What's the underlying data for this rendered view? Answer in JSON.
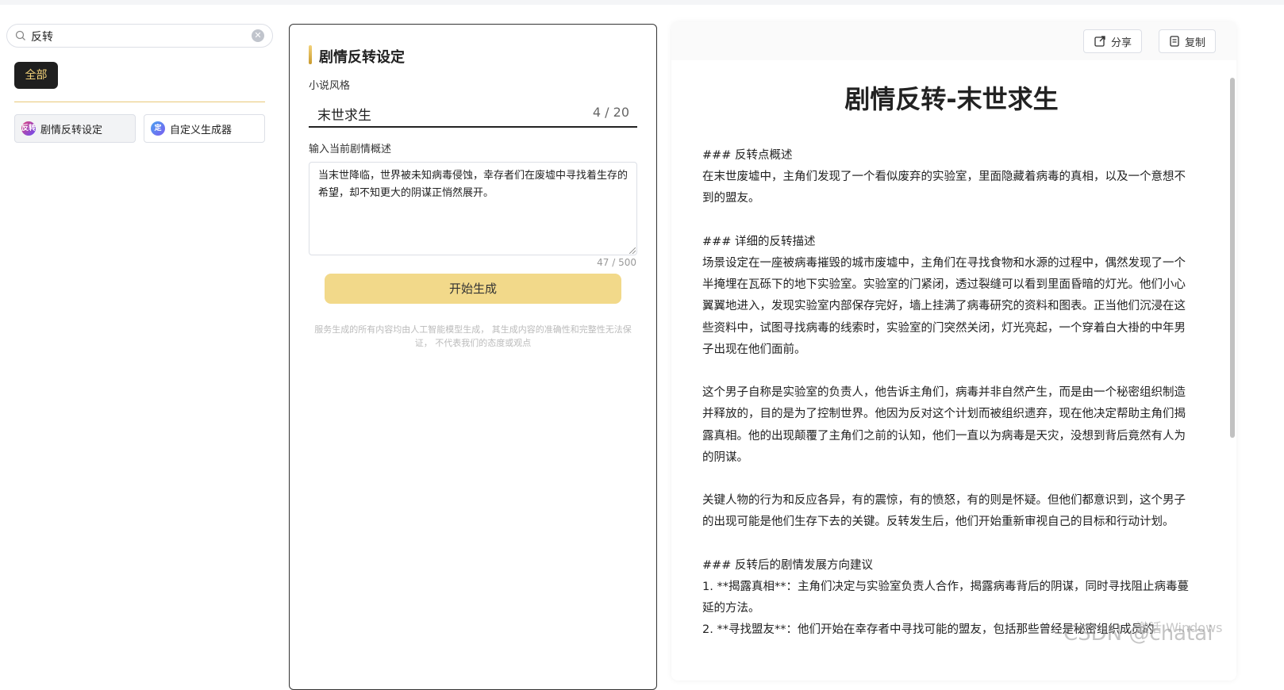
{
  "sidebar": {
    "search": {
      "value": "反转"
    },
    "category": "全部",
    "tools": [
      {
        "label": "剧情反转设定",
        "icon_text": "反转"
      },
      {
        "label": "自定义生成器",
        "icon_text": "定"
      }
    ]
  },
  "form": {
    "title": "剧情反转设定",
    "style_label": "小说风格",
    "style_value": "末世求生",
    "style_count": "4 / 20",
    "summary_label": "输入当前剧情概述",
    "summary_value": "当末世降临，世界被未知病毒侵蚀，幸存者们在废墟中寻找着生存的希望，却不知更大的阴谋正悄然展开。",
    "summary_count": "47 / 500",
    "generate_label": "开始生成",
    "disclaimer": "服务生成的所有内容均由人工智能模型生成， 其生成内容的准确性和完整性无法保证， 不代表我们的态度或观点"
  },
  "result": {
    "share_label": "分享",
    "copy_label": "复制",
    "title": "剧情反转-末世求生",
    "paragraphs": [
      "### 反转点概述",
      "在末世废墟中，主角们发现了一个看似废弃的实验室，里面隐藏着病毒的真相，以及一个意想不到的盟友。",
      "",
      "### 详细的反转描述",
      "场景设定在一座被病毒摧毁的城市废墟中，主角们在寻找食物和水源的过程中，偶然发现了一个半掩埋在瓦砾下的地下实验室。实验室的门紧闭，透过裂缝可以看到里面昏暗的灯光。他们小心翼翼地进入，发现实验室内部保存完好，墙上挂满了病毒研究的资料和图表。正当他们沉浸在这些资料中，试图寻找病毒的线索时，实验室的门突然关闭，灯光亮起，一个穿着白大褂的中年男子出现在他们面前。",
      "",
      "这个男子自称是实验室的负责人，他告诉主角们，病毒并非自然产生，而是由一个秘密组织制造并释放的，目的是为了控制世界。他因为反对这个计划而被组织遗弃，现在他决定帮助主角们揭露真相。他的出现颠覆了主角们之前的认知，他们一直以为病毒是天灾，没想到背后竟然有人为的阴谋。",
      "",
      "关键人物的行为和反应各异，有的震惊，有的愤怒，有的则是怀疑。但他们都意识到，这个男子的出现可能是他们生存下去的关键。反转发生后，他们开始重新审视自己的目标和行动计划。",
      "",
      "### 反转后的剧情发展方向建议",
      "1. **揭露真相**：主角们决定与实验室负责人合作，揭露病毒背后的阴谋，同时寻找阻止病毒蔓延的方法。",
      "2. **寻找盟友**：他们开始在幸存者中寻找可能的盟友，包括那些曾经是秘密组织成员的"
    ]
  },
  "watermarks": {
    "windows": "激活 Windows",
    "csdn": "CSDN @chatai"
  }
}
